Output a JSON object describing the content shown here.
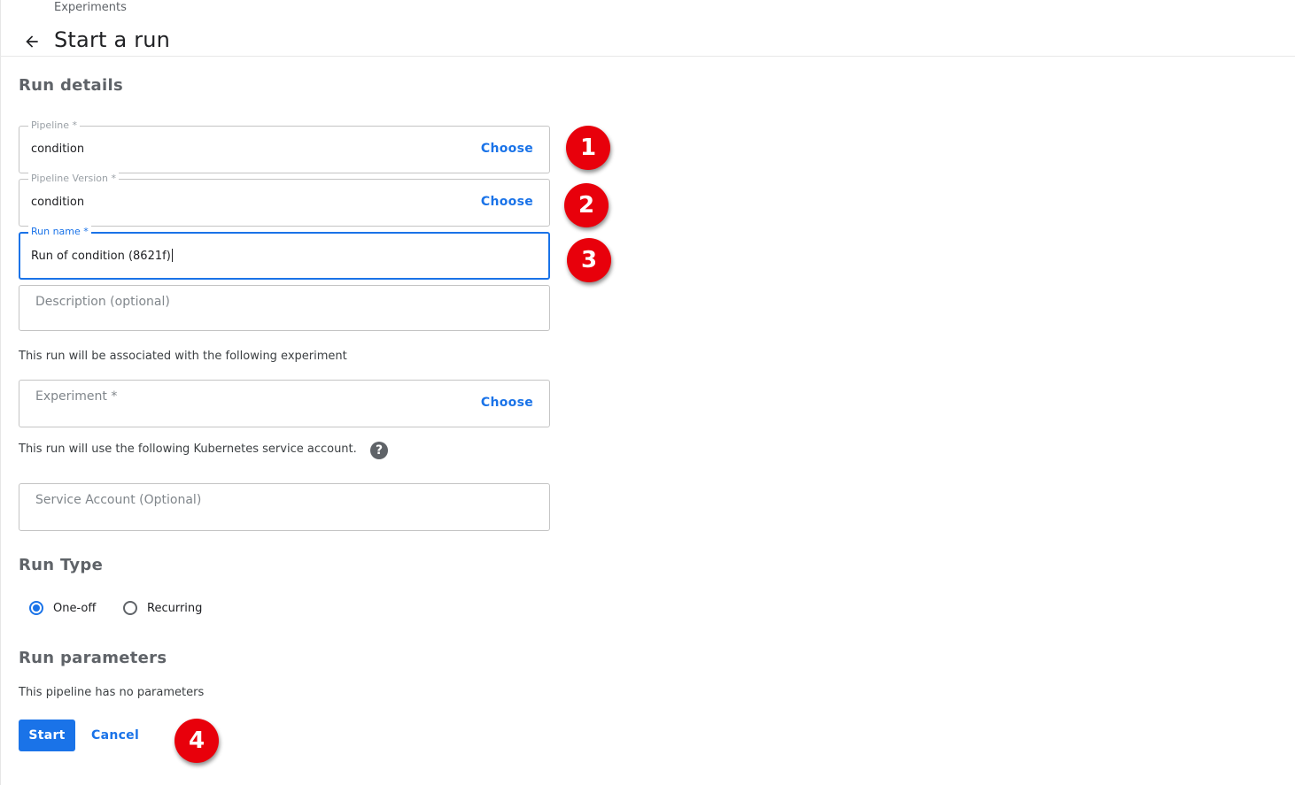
{
  "header": {
    "breadcrumb": "Experiments",
    "title": "Start a run",
    "back_icon": "arrow-left-icon"
  },
  "run_details": {
    "title": "Run details",
    "pipeline": {
      "label": "Pipeline *",
      "value": "condition",
      "action": "Choose"
    },
    "pipeline_version": {
      "label": "Pipeline Version *",
      "value": "condition",
      "action": "Choose"
    },
    "run_name": {
      "label": "Run name *",
      "value": "Run of condition (8621f)"
    },
    "description": {
      "placeholder": "Description (optional)"
    },
    "experiment_note": "This run will be associated with the following experiment",
    "experiment": {
      "placeholder": "Experiment *",
      "action": "Choose"
    },
    "service_account_note": "This run will use the following Kubernetes service account.",
    "help_icon": "?",
    "service_account": {
      "placeholder": "Service Account (Optional)"
    }
  },
  "run_type": {
    "title": "Run Type",
    "options": [
      {
        "label": "One-off",
        "selected": true
      },
      {
        "label": "Recurring",
        "selected": false
      }
    ]
  },
  "run_parameters": {
    "title": "Run parameters",
    "note": "This pipeline has no parameters"
  },
  "actions": {
    "start": "Start",
    "cancel": "Cancel"
  },
  "annotations": [
    "1",
    "2",
    "3",
    "4"
  ],
  "colors": {
    "accent": "#1a73e8",
    "annotation": "#e8000b"
  }
}
